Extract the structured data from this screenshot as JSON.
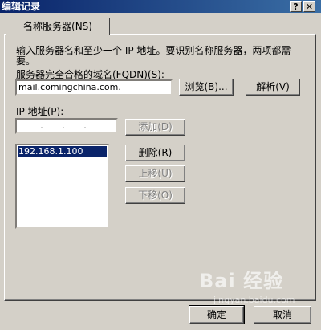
{
  "window": {
    "title": "编辑记录",
    "help_glyph": "?",
    "close_glyph": "✕"
  },
  "tab": {
    "label": "名称服务器(NS)"
  },
  "form": {
    "description_line1": "输入服务器名和至少一个 IP 地址。要识别名称服务器，两项都需",
    "description_line2": "要。",
    "fqdn_label": "服务器完全合格的域名(FQDN)(S):",
    "fqdn_value": "mail.comingchina.com.",
    "browse_button": "浏览(B)...",
    "resolve_button": "解析(V)",
    "ip_label": "IP 地址(P):",
    "ip_input_value": ". . .",
    "add_button": "添加(D)",
    "ip_list": [
      "192.168.1.100"
    ],
    "delete_button": "删除(R)",
    "move_up_button": "上移(U)",
    "move_down_button": "下移(O)"
  },
  "footer": {
    "ok_button": "确定",
    "cancel_button": "取消"
  },
  "watermark": {
    "logo_text": "Bai 经验",
    "url_text": "jingyan.baidu.com"
  }
}
